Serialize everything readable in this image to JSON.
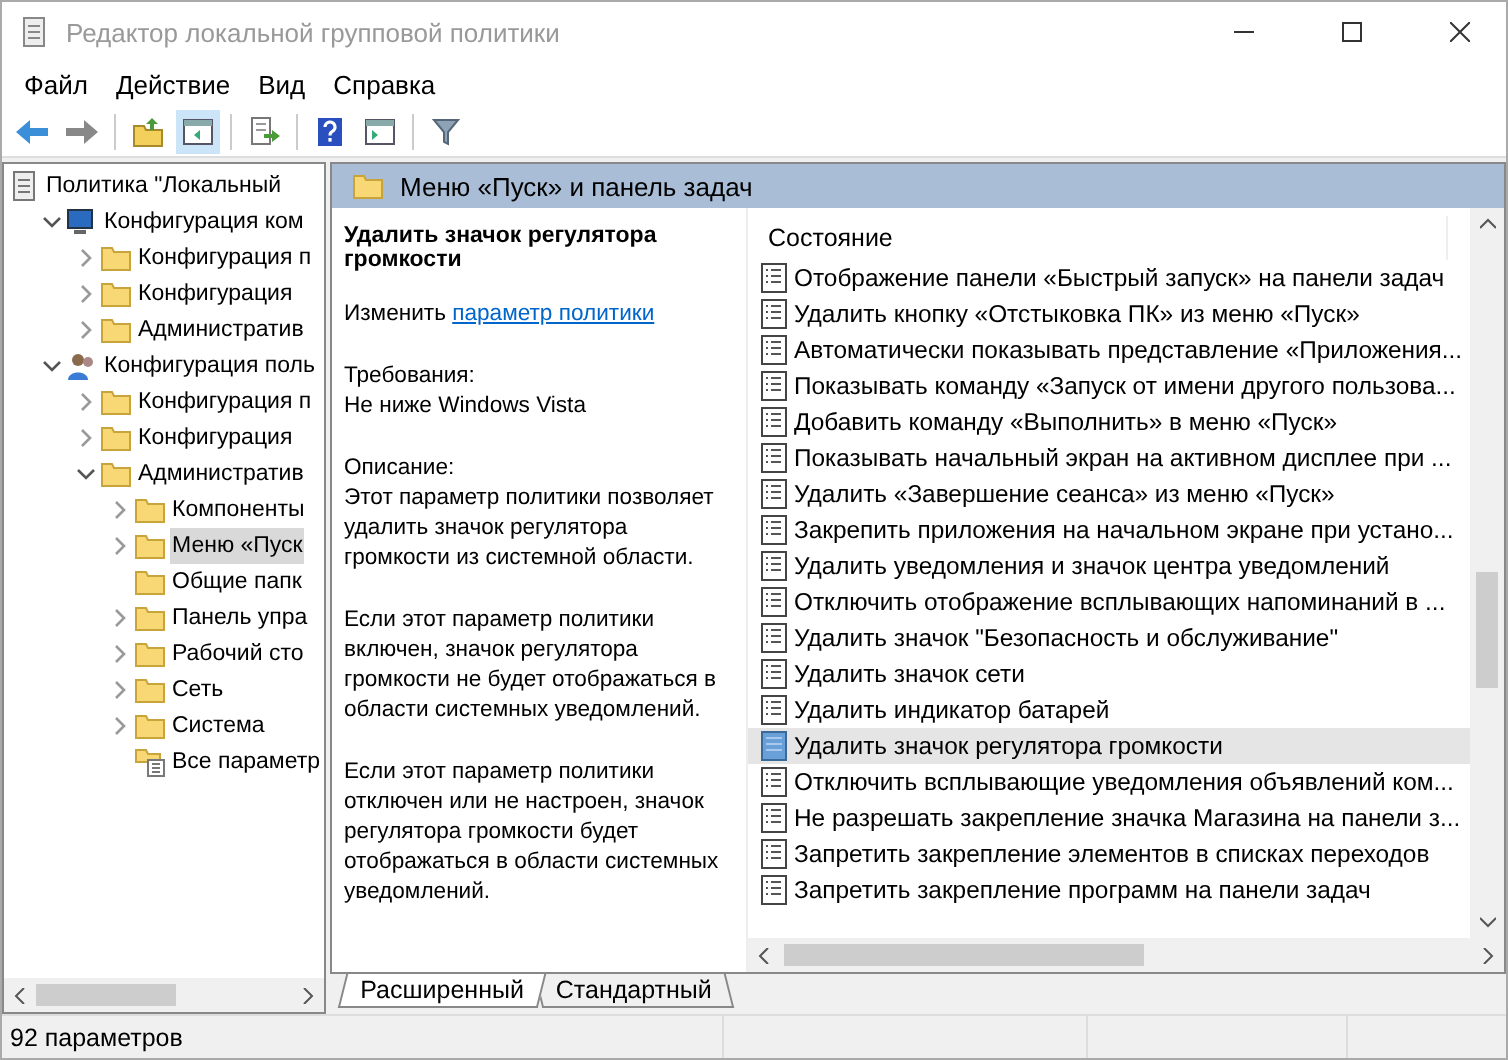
{
  "window": {
    "title": "Редактор локальной групповой политики"
  },
  "menu": [
    "Файл",
    "Действие",
    "Вид",
    "Справка"
  ],
  "toolbar": [
    {
      "kind": "back"
    },
    {
      "kind": "forward"
    },
    {
      "kind": "sep"
    },
    {
      "kind": "up"
    },
    {
      "kind": "tree"
    },
    {
      "kind": "sep"
    },
    {
      "kind": "export"
    },
    {
      "kind": "sep"
    },
    {
      "kind": "help"
    },
    {
      "kind": "view"
    },
    {
      "kind": "sep"
    },
    {
      "kind": "filter"
    }
  ],
  "tree": {
    "root": {
      "label": "Политика \"Локальный",
      "kind": "policy"
    },
    "children": [
      {
        "label": "Конфигурация ком",
        "kind": "computer",
        "expandable": true,
        "expanded": true,
        "selected": false,
        "children": [
          {
            "label": "Конфигурация п",
            "kind": "folder",
            "expandable": true,
            "expanded": false,
            "selected": false
          },
          {
            "label": "Конфигурация",
            "kind": "folder",
            "expandable": true,
            "expanded": false,
            "selected": false
          },
          {
            "label": "Административ",
            "kind": "folder",
            "expandable": true,
            "expanded": false,
            "selected": false
          }
        ]
      },
      {
        "label": "Конфигурация поль",
        "kind": "user",
        "expandable": true,
        "expanded": true,
        "selected": false,
        "children": [
          {
            "label": "Конфигурация п",
            "kind": "folder",
            "expandable": true,
            "expanded": false,
            "selected": false
          },
          {
            "label": "Конфигурация",
            "kind": "folder",
            "expandable": true,
            "expanded": false,
            "selected": false
          },
          {
            "label": "Административ",
            "kind": "folder",
            "expandable": true,
            "expanded": true,
            "selected": false,
            "children": [
              {
                "label": "Компоненты",
                "kind": "folder",
                "expandable": true,
                "expanded": false,
                "selected": false
              },
              {
                "label": "Меню «Пуск",
                "kind": "folder",
                "expandable": true,
                "expanded": false,
                "selected": true
              },
              {
                "label": "Общие папк",
                "kind": "folder",
                "expandable": false,
                "expanded": false,
                "selected": false
              },
              {
                "label": "Панель упра",
                "kind": "folder",
                "expandable": true,
                "expanded": false,
                "selected": false
              },
              {
                "label": "Рабочий сто",
                "kind": "folder",
                "expandable": true,
                "expanded": false,
                "selected": false
              },
              {
                "label": "Сеть",
                "kind": "folder",
                "expandable": true,
                "expanded": false,
                "selected": false
              },
              {
                "label": "Система",
                "kind": "folder",
                "expandable": true,
                "expanded": false,
                "selected": false
              },
              {
                "label": "Все параметр",
                "kind": "settings",
                "expandable": false,
                "expanded": false,
                "selected": false
              }
            ]
          }
        ]
      }
    ]
  },
  "header": {
    "title": "Меню «Пуск» и панель задач"
  },
  "description": {
    "title": "Удалить значок регулятора громкости",
    "edit_prefix": "Изменить",
    "edit_link": "параметр политики",
    "requirements_label": "Требования:",
    "requirements": "Не ниже Windows Vista",
    "description_label": "Описание:",
    "paragraphs": [
      "Этот параметр политики позволяет удалить значок регулятора громкости из системной области.",
      "Если этот параметр политики включен, значок регулятора громкости не будет отображаться в области системных уведомлений.",
      "Если этот параметр политики отключен или не настроен, значок регулятора громкости будет отображаться в области системных уведомлений."
    ]
  },
  "list": {
    "column": "Состояние",
    "rows": [
      {
        "label": "Отображение панели «Быстрый запуск» на панели задач",
        "selected": false
      },
      {
        "label": "Удалить кнопку «Отстыковка ПК» из меню «Пуск»",
        "selected": false
      },
      {
        "label": "Автоматически показывать представление «Приложения...",
        "selected": false
      },
      {
        "label": "Показывать команду «Запуск от имени другого пользова...",
        "selected": false
      },
      {
        "label": "Добавить команду «Выполнить» в меню «Пуск»",
        "selected": false
      },
      {
        "label": "Показывать начальный экран на активном дисплее при ...",
        "selected": false
      },
      {
        "label": "Удалить «Завершение сеанса» из меню «Пуск»",
        "selected": false
      },
      {
        "label": "Закрепить приложения на начальном экране при устано...",
        "selected": false
      },
      {
        "label": "Удалить уведомления и значок центра уведомлений",
        "selected": false
      },
      {
        "label": "Отключить отображение всплывающих напоминаний в ...",
        "selected": false
      },
      {
        "label": "Удалить значок \"Безопасность и обслуживание\"",
        "selected": false
      },
      {
        "label": "Удалить значок сети",
        "selected": false
      },
      {
        "label": "Удалить индикатор батарей",
        "selected": false
      },
      {
        "label": "Удалить значок регулятора громкости",
        "selected": true
      },
      {
        "label": "Отключить всплывающие уведомления объявлений ком...",
        "selected": false
      },
      {
        "label": "Не разрешать закрепление значка Магазина на панели з...",
        "selected": false
      },
      {
        "label": "Запретить закрепление элементов в списках переходов",
        "selected": false
      },
      {
        "label": "Запретить закрепление программ на панели задач",
        "selected": false
      }
    ]
  },
  "tabs": [
    {
      "label": "Расширенный",
      "selected": true
    },
    {
      "label": "Стандартный",
      "selected": false
    }
  ],
  "status_bar": "92 параметров"
}
